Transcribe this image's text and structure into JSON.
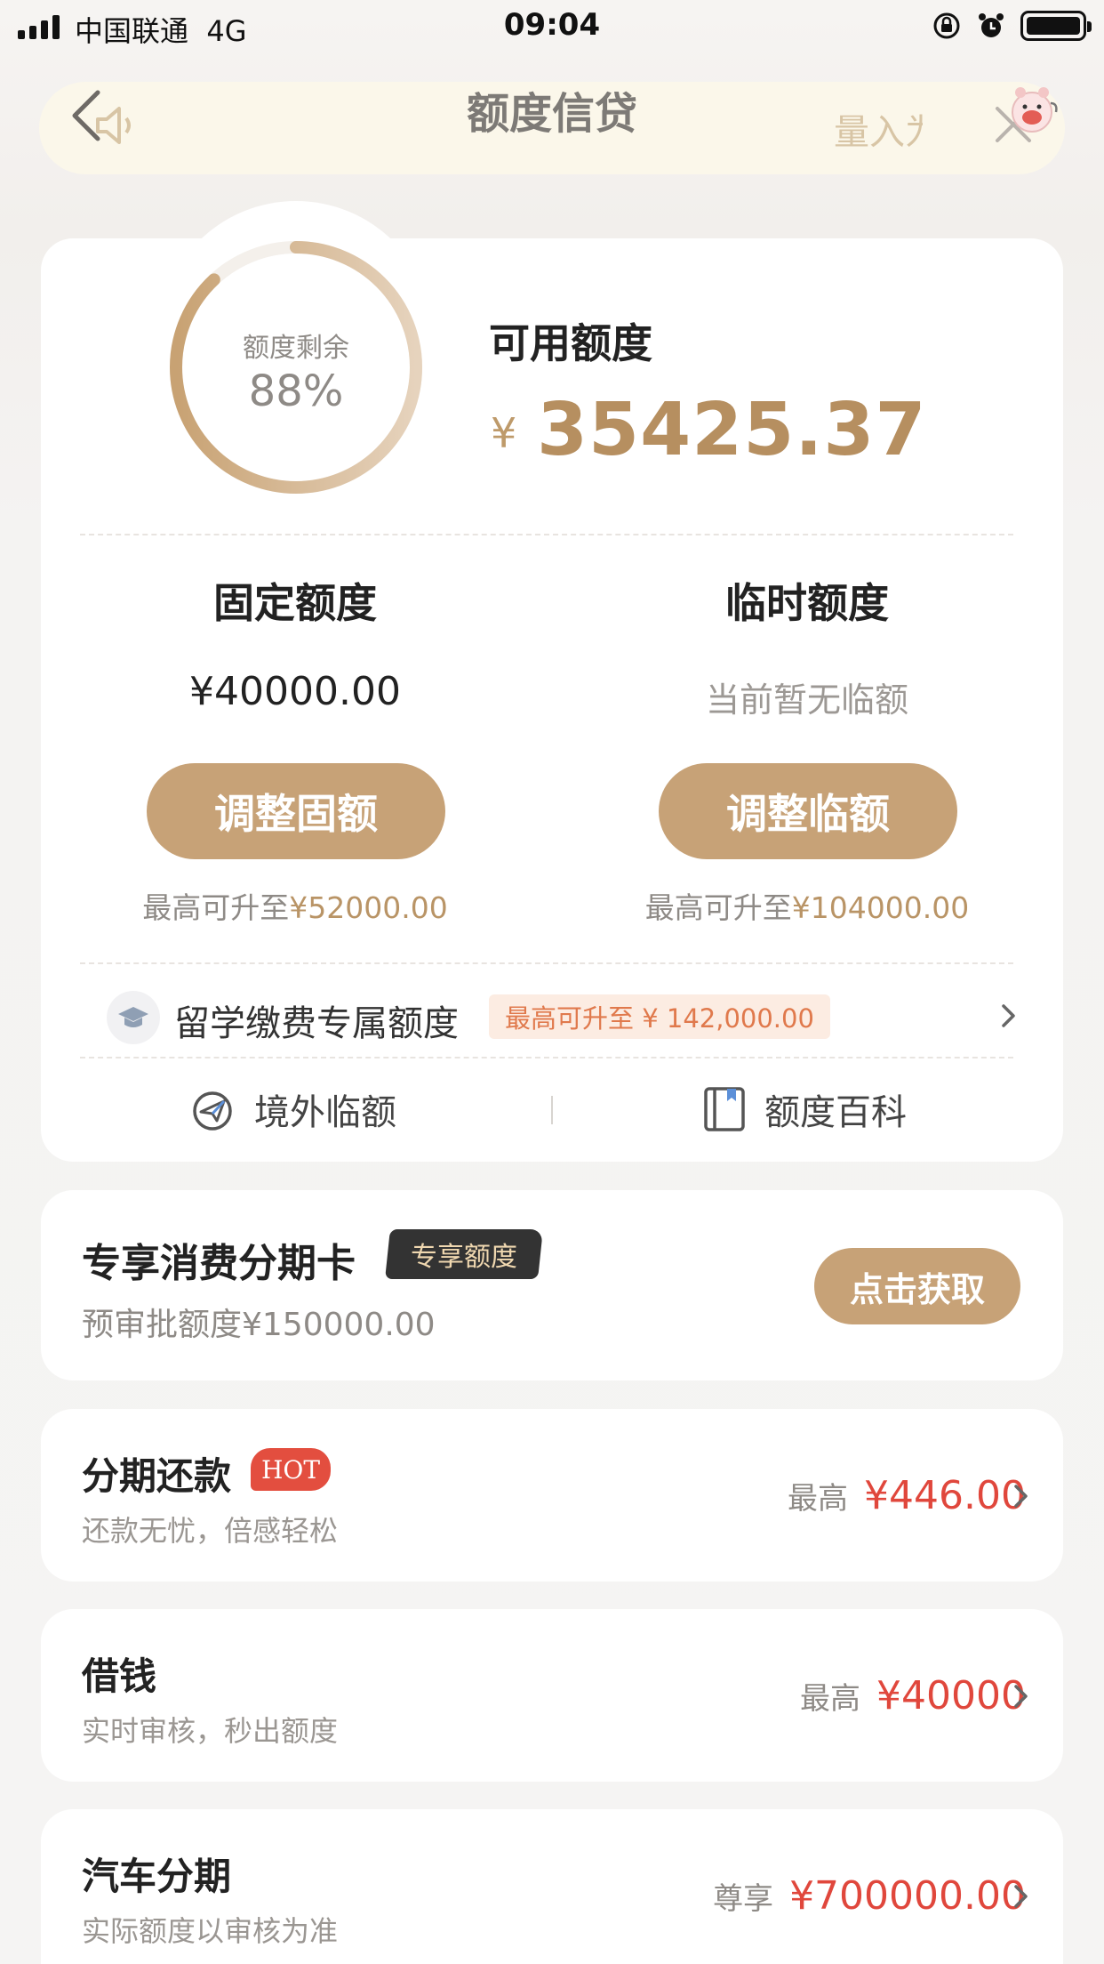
{
  "status_bar": {
    "carrier": "中国联通",
    "network": "4G",
    "time": "09:04"
  },
  "header": {
    "title": "额度信贷",
    "marquee_text": "量入为"
  },
  "credit": {
    "ring_label": "额度剩余",
    "ring_percent": "88%",
    "ring_fraction": 0.88,
    "available_label": "可用额度",
    "currency_symbol": "¥",
    "available_amount": "35425.37"
  },
  "fixed": {
    "title": "固定额度",
    "amount": "¥40000.00",
    "button": "调整固额",
    "note_prefix": "最高可升至",
    "note_amount": "¥52000.00"
  },
  "temporary": {
    "title": "临时额度",
    "amount_text": "当前暂无临额",
    "button": "调整临额",
    "note_prefix": "最高可升至",
    "note_amount": "¥104000.00"
  },
  "study_abroad": {
    "label": "留学缴费专属额度",
    "tag": "最高可升至 ¥ 142,000.00"
  },
  "links": {
    "overseas": "境外临额",
    "encyclopedia": "额度百科"
  },
  "installment_card": {
    "title": "专享消费分期卡",
    "badge": "专享额度",
    "subtitle": "预审批额度¥150000.00",
    "button": "点击获取"
  },
  "services": [
    {
      "title": "分期还款",
      "badge": "HOT",
      "subtitle": "还款无忧，倍感轻松",
      "prefix": "最高",
      "amount": "¥446.00"
    },
    {
      "title": "借钱",
      "subtitle": "实时审核，秒出额度",
      "prefix": "最高",
      "amount": "¥40000"
    },
    {
      "title": "汽车分期",
      "subtitle": "实际额度以审核为准",
      "prefix": "尊享",
      "amount": "¥700000.00"
    }
  ],
  "colors": {
    "gold": "#c7a277",
    "amount_red": "#e0473c",
    "hot_red": "#e34e3f"
  }
}
